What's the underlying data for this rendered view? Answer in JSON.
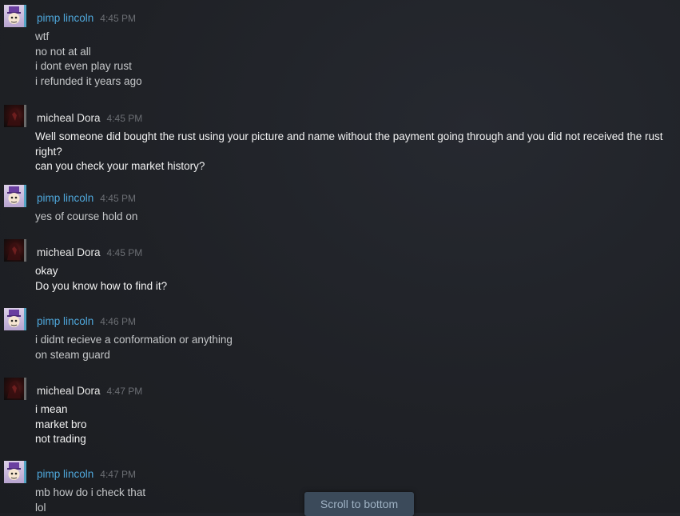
{
  "messages": [
    {
      "sender": "pimp lincoln",
      "time": "4:45 PM",
      "lines": [
        "wtf",
        "no not at all",
        "i dont even play rust",
        "i refunded it years ago"
      ]
    },
    {
      "sender": "micheal Dora",
      "time": "4:45 PM",
      "lines": [
        "Well someone did bought the rust using your picture and name without the payment going through and you did not received the rust right?",
        "can you check your market history?"
      ]
    },
    {
      "sender": "pimp lincoln",
      "time": "4:45 PM",
      "lines": [
        "yes of course hold on"
      ]
    },
    {
      "sender": "micheal Dora",
      "time": "4:45 PM",
      "lines": [
        "okay",
        "Do you know how to find it?"
      ]
    },
    {
      "sender": "pimp lincoln",
      "time": "4:46 PM",
      "lines": [
        "i didnt recieve a conformation or anything",
        "on steam guard"
      ]
    },
    {
      "sender": "micheal Dora",
      "time": "4:47 PM",
      "lines": [
        "i mean",
        "market bro",
        "not trading"
      ]
    },
    {
      "sender": "pimp lincoln",
      "time": "4:47 PM",
      "lines": [
        "mb how do i check that",
        "lol"
      ]
    }
  ],
  "scroll_to_bottom_label": "Scroll to bottom",
  "colors": {
    "friend_name": "#4fa8dc",
    "other_name": "#e6e6e6",
    "timestamp": "#6b6e73",
    "scroll_button_bg": "#3b4a5a"
  },
  "icons": {
    "friend_avatar": "cartoon-lincoln-avatar",
    "other_avatar": "dark-red-avatar"
  }
}
